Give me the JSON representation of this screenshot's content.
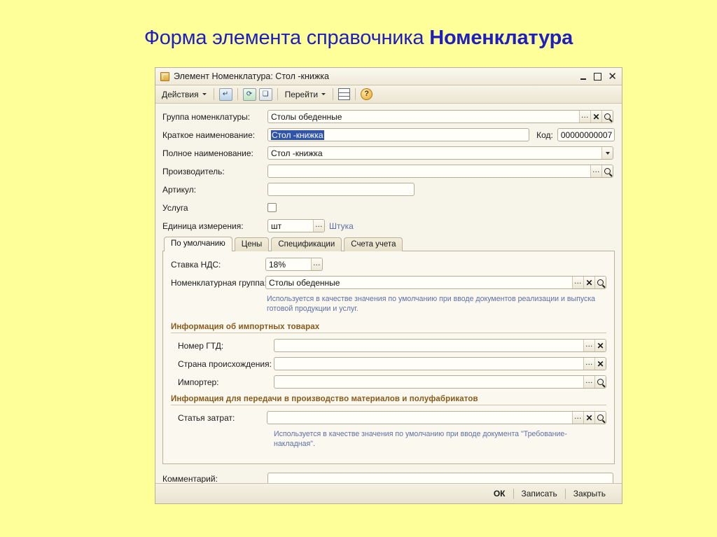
{
  "slide": {
    "title_normal": "Форма элемента справочника ",
    "title_bold": "Номенклатура"
  },
  "window": {
    "title": "Элемент Номенклатура: Стол -книжка",
    "icon": "catalog-item-icon",
    "buttons": {
      "minimize": "_",
      "maximize": "□",
      "close": "✕"
    }
  },
  "toolbar": {
    "actions_label": "Действия",
    "goto_label": "Перейти",
    "icons": {
      "save": "save-icon",
      "refresh": "save-and-close-icon",
      "copy": "copy-icon",
      "list": "list-icon",
      "help": "?"
    }
  },
  "form": {
    "group": {
      "label": "Группа номенклатуры:",
      "value": "Столы обеденные"
    },
    "short_name": {
      "label": "Краткое наименование:",
      "value": "Стол -книжка"
    },
    "code": {
      "label": "Код:",
      "value": "00000000007"
    },
    "full_name": {
      "label": "Полное наименование:",
      "value": "Стол -книжка"
    },
    "manufacturer": {
      "label": "Производитель:",
      "value": ""
    },
    "article": {
      "label": "Артикул:",
      "value": ""
    },
    "service": {
      "label": "Услуга",
      "checked": false
    },
    "unit": {
      "label": "Единица измерения:",
      "value": "шт",
      "hint": "Штука"
    },
    "comment": {
      "label": "Комментарий:",
      "value": ""
    }
  },
  "tabs": [
    {
      "label": "По умолчанию",
      "active": true
    },
    {
      "label": "Цены",
      "active": false
    },
    {
      "label": "Спецификации",
      "active": false
    },
    {
      "label": "Счета учета",
      "active": false
    }
  ],
  "tab_default": {
    "vat_rate": {
      "label": "Ставка НДС:",
      "value": "18%"
    },
    "nomenclature_group": {
      "label": "Номенклатурная группа:",
      "value": "Столы обеденные"
    },
    "hint_1": "Используется в качестве значения по умолчанию при вводе документов  реализации и выпуска готовой продукции и услуг.",
    "import_section": {
      "title": "Информация об импортных товарах",
      "gtd_number": {
        "label": "Номер ГТД:",
        "value": ""
      },
      "country": {
        "label": "Страна происхождения:",
        "value": ""
      },
      "importer": {
        "label": "Импортер:",
        "value": ""
      }
    },
    "production_section": {
      "title": "Информация для передачи в производство материалов и полуфабрикатов",
      "cost_item": {
        "label": "Статья затрат:",
        "value": ""
      },
      "hint_2": "Используется в качестве значения по умолчанию при вводе документа \"Требование-накладная\"."
    }
  },
  "footer": {
    "ok": "ОК",
    "write": "Записать",
    "close": "Закрыть"
  },
  "colors": {
    "slide_background": "#ffff99",
    "title_text": "#1f1fbf",
    "window_background": "#f7f4e9",
    "section_title": "#8a5a1a",
    "hint_text": "#5f6fa8",
    "selection": "#2f54a8"
  }
}
